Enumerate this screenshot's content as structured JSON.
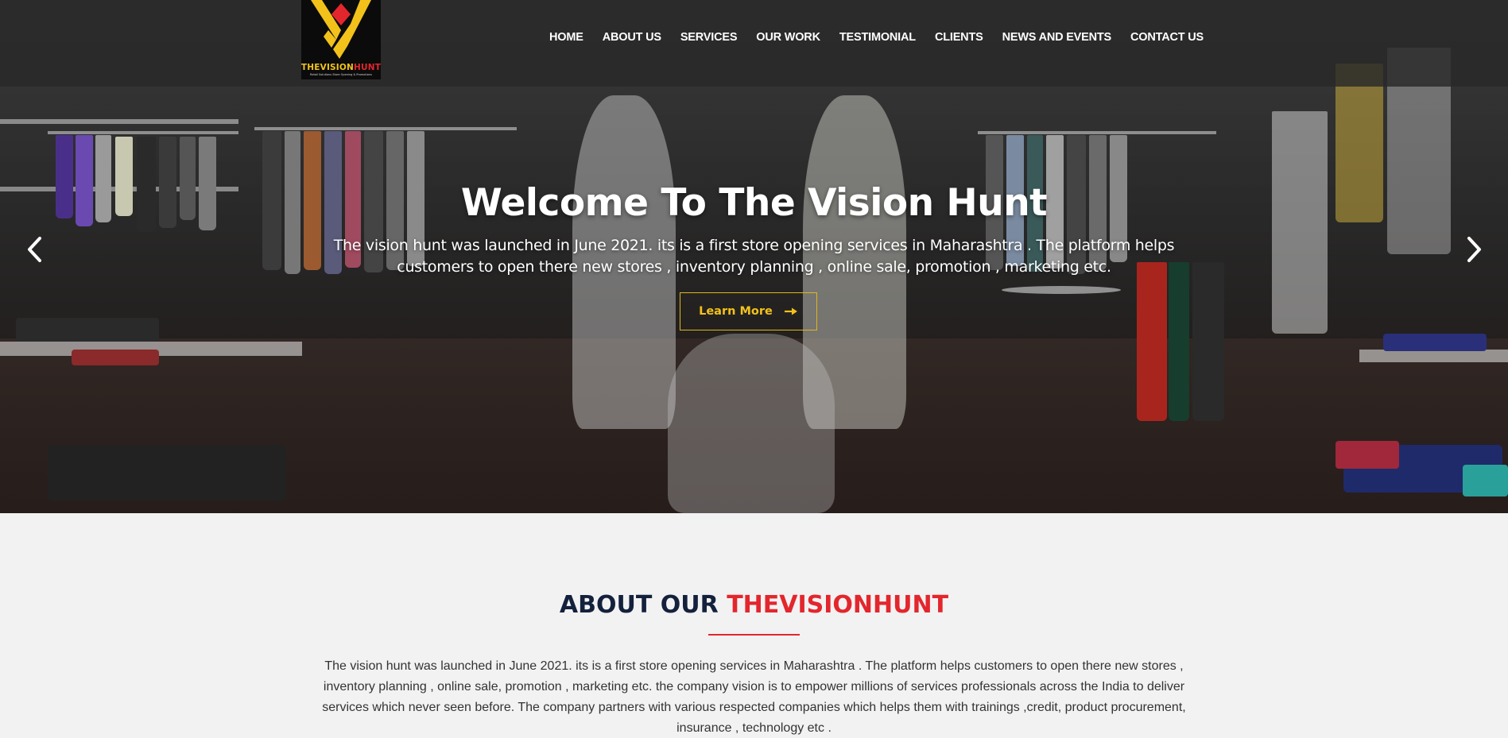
{
  "brand": {
    "logo_word_1": "THEVISION",
    "logo_word_2": "HUNT",
    "logo_tagline": "Retail Solutions Store Opening & Promotions",
    "logo_icon": "vision-hunt-diamond-logo",
    "colors": {
      "gold": "#f2c21b",
      "red": "#e3262d",
      "navy": "#14213d"
    }
  },
  "nav": {
    "items": [
      {
        "label": "HOME"
      },
      {
        "label": "ABOUT US"
      },
      {
        "label": "SERVICES"
      },
      {
        "label": "OUR WORK"
      },
      {
        "label": "TESTIMONIAL"
      },
      {
        "label": "CLIENTS"
      },
      {
        "label": "NEWS AND EVENTS"
      },
      {
        "label": "CONTACT US"
      }
    ]
  },
  "hero": {
    "title": "Welcome To The Vision Hunt",
    "subtitle": "The vision hunt was launched in June 2021. its is a first store opening services in Maharashtra . The platform helps customers to open there new stores , inventory planning , online sale, promotion , marketing etc.",
    "button_label": "Learn More",
    "button_icon": "long-arrow-right-icon",
    "prev_icon": "chevron-left-icon",
    "next_icon": "chevron-right-icon"
  },
  "about": {
    "title_prefix": "ABOUT OUR ",
    "title_brand": "THEVISIONHUNT",
    "body": "The vision hunt was launched in June 2021. its is a first store opening services in Maharashtra . The platform helps customers to open there new stores , inventory planning , online sale, promotion , marketing etc. the company vision is to empower millions of services professionals across the India to deliver services which never seen before. The company partners with various respected companies which helps them with trainings ,credit, product procurement, insurance , technology etc ."
  }
}
